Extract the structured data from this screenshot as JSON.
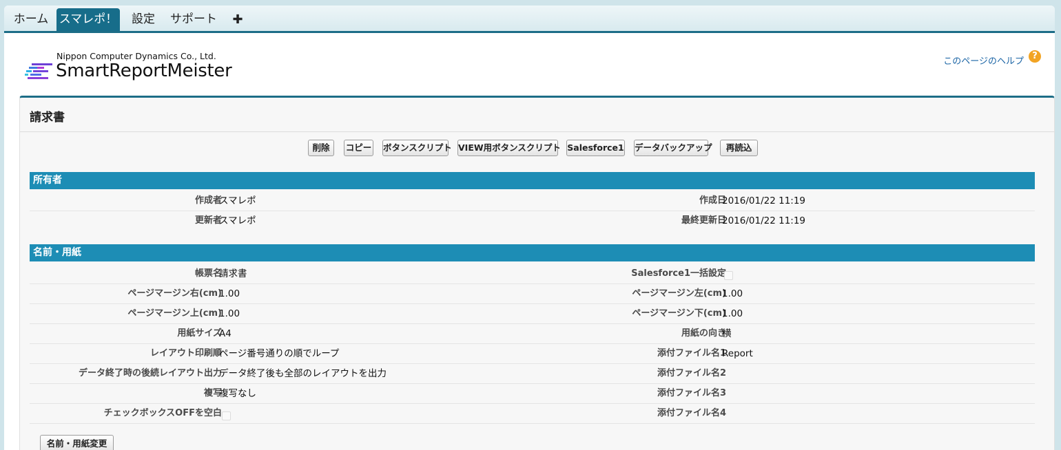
{
  "tabs": [
    {
      "label": "ホーム",
      "active": false
    },
    {
      "label": "スマレポ！",
      "active": true
    },
    {
      "label": "設定",
      "active": false
    },
    {
      "label": "サポート",
      "active": false
    }
  ],
  "header": {
    "company": "Nippon Computer Dynamics Co., Ltd.",
    "app_name": "SmartReportMeister",
    "help_link": "このページのヘルプ",
    "help_icon": "?"
  },
  "record": {
    "title": "請求書",
    "buttons": [
      "削除",
      "コピー",
      "ボタンスクリプト",
      "VIEW用ボタンスクリプト",
      "Salesforce1",
      "データバックアップ",
      "再読込"
    ]
  },
  "owner_section": {
    "title": "所有者",
    "rows": [
      {
        "left_label": "作成者",
        "left_value": "スマレポ",
        "right_label": "作成日",
        "right_value": "2016/01/22 11:19"
      },
      {
        "left_label": "更新者",
        "left_value": "スマレポ",
        "right_label": "最終更新日",
        "right_value": "2016/01/22 11:19"
      }
    ]
  },
  "paper_section": {
    "title": "名前・用紙",
    "rows": [
      {
        "left_label": "帳票名",
        "left_value": "請求書",
        "right_label": "Salesforce1一括設定",
        "right_value": ""
      },
      {
        "left_label": "ページマージン右(cm)",
        "left_value": "1.00",
        "right_label": "ページマージン左(cm)",
        "right_value": "1.00"
      },
      {
        "left_label": "ページマージン上(cm)",
        "left_value": "1.00",
        "right_label": "ページマージン下(cm)",
        "right_value": "1.00"
      },
      {
        "left_label": "用紙サイズ",
        "left_value": "A4",
        "right_label": "用紙の向き",
        "right_value": "横"
      },
      {
        "left_label": "レイアウト印刷順",
        "left_value": "ページ番号通りの順でループ",
        "right_label": "添付ファイル名1",
        "right_value": "Report"
      },
      {
        "left_label": "データ終了時の後続レイアウト出力",
        "left_value": "データ終了後も全部のレイアウトを出力",
        "right_label": "添付ファイル名2",
        "right_value": ""
      },
      {
        "left_label": "複写",
        "left_value": "複写なし",
        "right_label": "添付ファイル名3",
        "right_value": ""
      },
      {
        "left_label": "チェックボックスOFFを空白",
        "left_value": "",
        "right_label": "添付ファイル名4",
        "right_value": ""
      }
    ],
    "change_button": "名前・用紙変更"
  }
}
